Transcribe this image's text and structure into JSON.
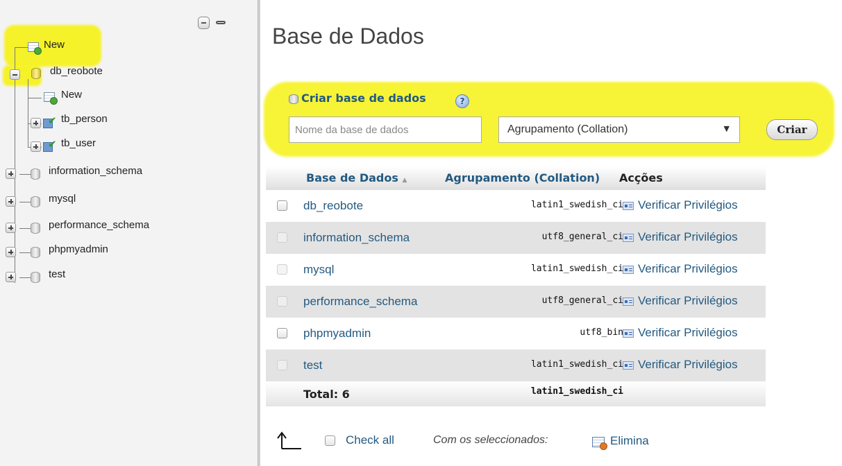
{
  "navigation": {
    "tree": [
      {
        "label": "New",
        "type": "new"
      },
      {
        "label": "db_reobote",
        "type": "database",
        "expanded": true,
        "children": [
          {
            "label": "New",
            "type": "new"
          },
          {
            "label": "tb_person",
            "type": "table"
          },
          {
            "label": "tb_user",
            "type": "table"
          }
        ]
      },
      {
        "label": "information_schema",
        "type": "database"
      },
      {
        "label": "mysql",
        "type": "database"
      },
      {
        "label": "performance_schema",
        "type": "database"
      },
      {
        "label": "phpmyadmin",
        "type": "database"
      },
      {
        "label": "test",
        "type": "database"
      }
    ],
    "controls": [
      "collapse-all-icon",
      "link-icon"
    ]
  },
  "page": {
    "title": "Base de Dados"
  },
  "create_database": {
    "heading": "Criar base de dados",
    "name_placeholder": "Nome da base de dados",
    "collation_selected": "Agrupamento (Collation)",
    "submit_label": "Criar"
  },
  "databases_table": {
    "headers": {
      "name": "Base de Dados",
      "sort_indicator": "▲",
      "collation": "Agrupamento (Collation)",
      "actions": "Acções"
    },
    "rows": [
      {
        "name": "db_reobote",
        "collation": "latin1_swedish_ci",
        "action": "Verificar Privilégios"
      },
      {
        "name": "information_schema",
        "collation": "utf8_general_ci",
        "action": "Verificar Privilégios"
      },
      {
        "name": "mysql",
        "collation": "latin1_swedish_ci",
        "action": "Verificar Privilégios"
      },
      {
        "name": "performance_schema",
        "collation": "utf8_general_ci",
        "action": "Verificar Privilégios"
      },
      {
        "name": "phpmyadmin",
        "collation": "utf8_bin",
        "action": "Verificar Privilégios"
      },
      {
        "name": "test",
        "collation": "latin1_swedish_ci",
        "action": "Verificar Privilégios"
      }
    ],
    "footer": {
      "total": "Total: 6",
      "collation": "latin1_swedish_ci"
    }
  },
  "bulk_actions": {
    "check_all": "Check all",
    "with_selected": "Com os seleccionados:",
    "drop": "Elimina"
  },
  "colors": {
    "link": "#235a81",
    "highlight": "#f6f214",
    "row_alt": "#e3e3e3"
  }
}
